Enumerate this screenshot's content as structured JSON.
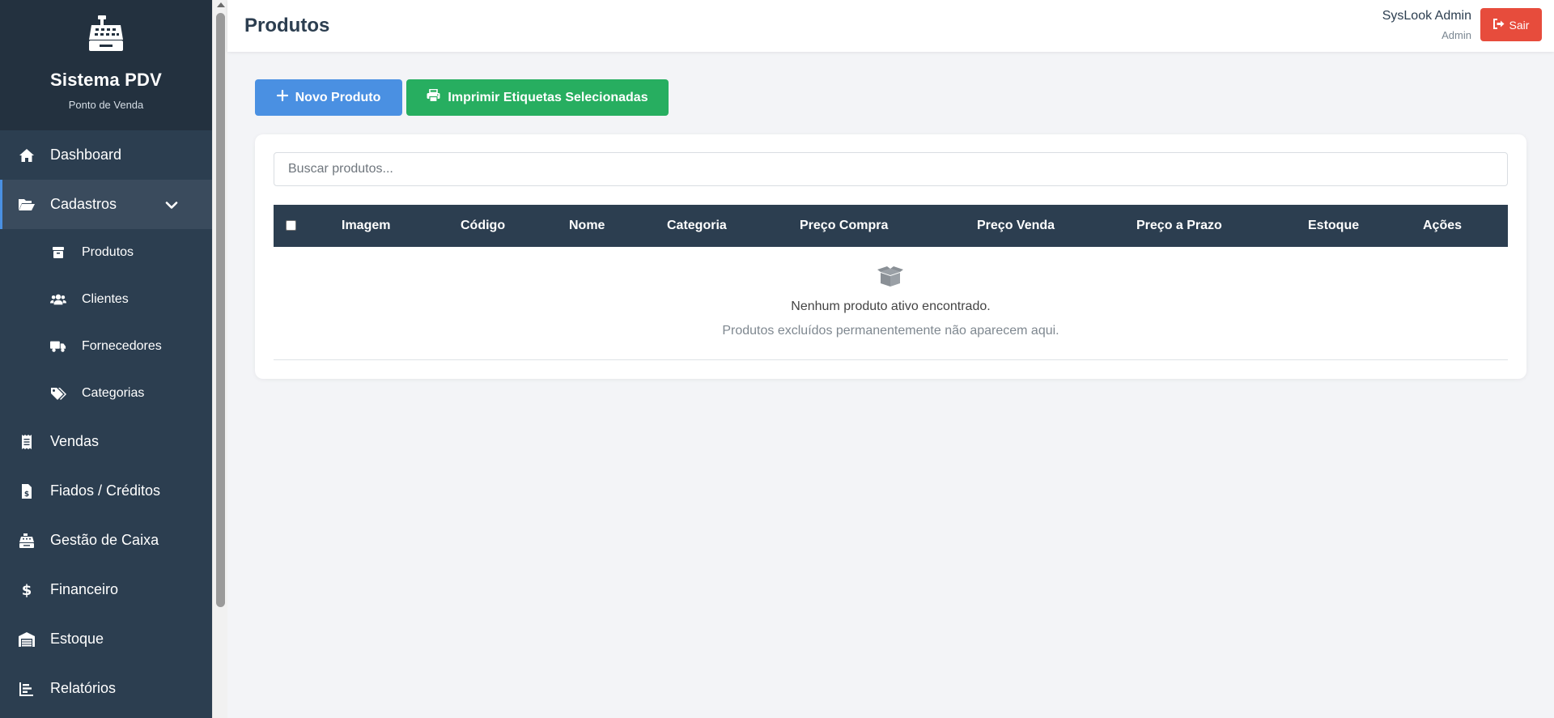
{
  "brand": {
    "title": "Sistema PDV",
    "subtitle": "Ponto de Venda",
    "icon": "cash-register-icon"
  },
  "sidebar": {
    "items": [
      {
        "label": "Dashboard",
        "icon": "home-icon"
      },
      {
        "label": "Cadastros",
        "icon": "folder-open-icon",
        "active": true,
        "expanded": true
      },
      {
        "label": "Vendas",
        "icon": "receipt-icon"
      },
      {
        "label": "Fiados / Créditos",
        "icon": "invoice-dollar-icon"
      },
      {
        "label": "Gestão de Caixa",
        "icon": "cash-register-icon"
      },
      {
        "label": "Financeiro",
        "icon": "dollar-icon"
      },
      {
        "label": "Estoque",
        "icon": "warehouse-icon"
      },
      {
        "label": "Relatórios",
        "icon": "bar-chart-icon"
      }
    ],
    "subitems": [
      {
        "label": "Produtos",
        "icon": "box-icon"
      },
      {
        "label": "Clientes",
        "icon": "users-icon"
      },
      {
        "label": "Fornecedores",
        "icon": "truck-icon"
      },
      {
        "label": "Categorias",
        "icon": "tags-icon"
      }
    ]
  },
  "header": {
    "title": "Produtos",
    "user_name": "SysLook Admin",
    "user_role": "Admin",
    "logout_label": "Sair"
  },
  "toolbar": {
    "new_product_label": "Novo Produto",
    "print_labels_label": "Imprimir Etiquetas Selecionadas"
  },
  "search": {
    "placeholder": "Buscar produtos...",
    "value": ""
  },
  "table": {
    "columns": [
      "Imagem",
      "Código",
      "Nome",
      "Categoria",
      "Preço Compra",
      "Preço Venda",
      "Preço a Prazo",
      "Estoque",
      "Ações"
    ],
    "rows": []
  },
  "empty": {
    "message": "Nenhum produto ativo encontrado.",
    "hint": "Produtos excluídos permanentemente não aparecem aqui."
  },
  "colors": {
    "sidebar": "#2c3e50",
    "primary": "#4a90e2",
    "success": "#27ae60",
    "danger": "#e74c3c"
  }
}
